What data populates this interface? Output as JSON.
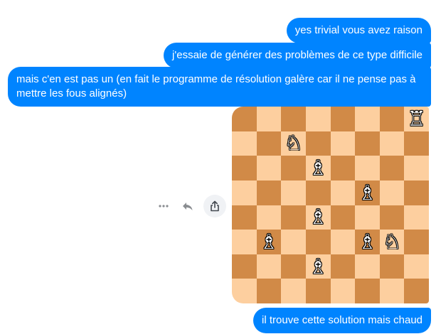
{
  "messages": [
    {
      "text": "yes trivial vous avez raison"
    },
    {
      "text": "j'essaie de générer des problèmes de ce type difficile"
    },
    {
      "text": "mais c'en est pas un (en fait le programme de résolution galère car il ne pense pas à mettre les fous alignés)"
    },
    {
      "text": "il trouve cette solution mais chaud"
    }
  ],
  "actions": {
    "more_icon": "more-horizontal-icon",
    "reply_icon": "reply-icon",
    "share_icon": "share-icon"
  },
  "board": {
    "light_color": "#fdcf9f",
    "dark_color": "#d18a47",
    "rows": [
      [
        "",
        "",
        "",
        "",
        "",
        "",
        "",
        "♖"
      ],
      [
        "",
        "",
        "♘",
        "",
        "",
        "",
        "",
        ""
      ],
      [
        "",
        "",
        "",
        "♗",
        "",
        "",
        "",
        ""
      ],
      [
        "",
        "",
        "",
        "",
        "",
        "♗",
        "",
        ""
      ],
      [
        "",
        "",
        "",
        "♗",
        "",
        "",
        "",
        ""
      ],
      [
        "",
        "♗",
        "",
        "",
        "",
        "♗",
        "♘",
        ""
      ],
      [
        "",
        "",
        "",
        "♗",
        "",
        "",
        "",
        ""
      ],
      [
        "",
        "",
        "",
        "",
        "",
        "",
        "",
        ""
      ]
    ]
  }
}
